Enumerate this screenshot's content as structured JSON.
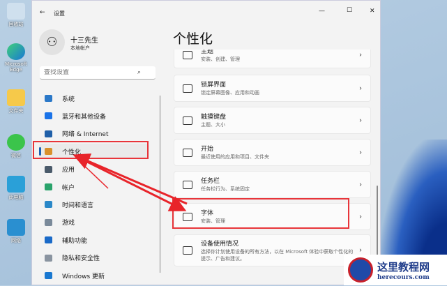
{
  "desktop": [
    "回收站",
    "Microsoft Edge",
    "文件夹",
    "微信",
    "此电脑",
    "网络"
  ],
  "window": {
    "title": "设置",
    "back": "←",
    "min": "—",
    "max": "☐",
    "close": "✕"
  },
  "user": {
    "name": "十三先生",
    "type": "本地帐户"
  },
  "search": {
    "placeholder": "查找设置"
  },
  "nav": [
    {
      "label": "系统",
      "color": "#2a78c8"
    },
    {
      "label": "蓝牙和其他设备",
      "color": "#1a73e8"
    },
    {
      "label": "网络 & Internet",
      "color": "#1f5fa8"
    },
    {
      "label": "个性化",
      "color": "#d9902c"
    },
    {
      "label": "应用",
      "color": "#4a5a6a"
    },
    {
      "label": "帐户",
      "color": "#2aa36b"
    },
    {
      "label": "时间和语言",
      "color": "#2a88c8"
    },
    {
      "label": "游戏",
      "color": "#7a8a9a"
    },
    {
      "label": "辅助功能",
      "color": "#1a6ac8"
    },
    {
      "label": "隐私和安全性",
      "color": "#8a94a0"
    },
    {
      "label": "Windows 更新",
      "color": "#1a78d0"
    }
  ],
  "page_title": "个性化",
  "cards": [
    {
      "title": "主题",
      "sub": "安装、创建、管理"
    },
    {
      "title": "锁屏界面",
      "sub": "锁定屏幕图像、应用和动画"
    },
    {
      "title": "触摸键盘",
      "sub": "主题、大小"
    },
    {
      "title": "开始",
      "sub": "最近使用的应用和项目、文件夹"
    },
    {
      "title": "任务栏",
      "sub": "任务栏行为、系统固定"
    },
    {
      "title": "字体",
      "sub": "安装、管理"
    },
    {
      "title": "设备使用情况",
      "sub": "选择你计划使用设备的所有方法，以在 Microsoft 体验中获取个性化的提示、广告和建议。"
    }
  ],
  "watermark": {
    "name": "这里教程网",
    "url": "herecours.com"
  }
}
